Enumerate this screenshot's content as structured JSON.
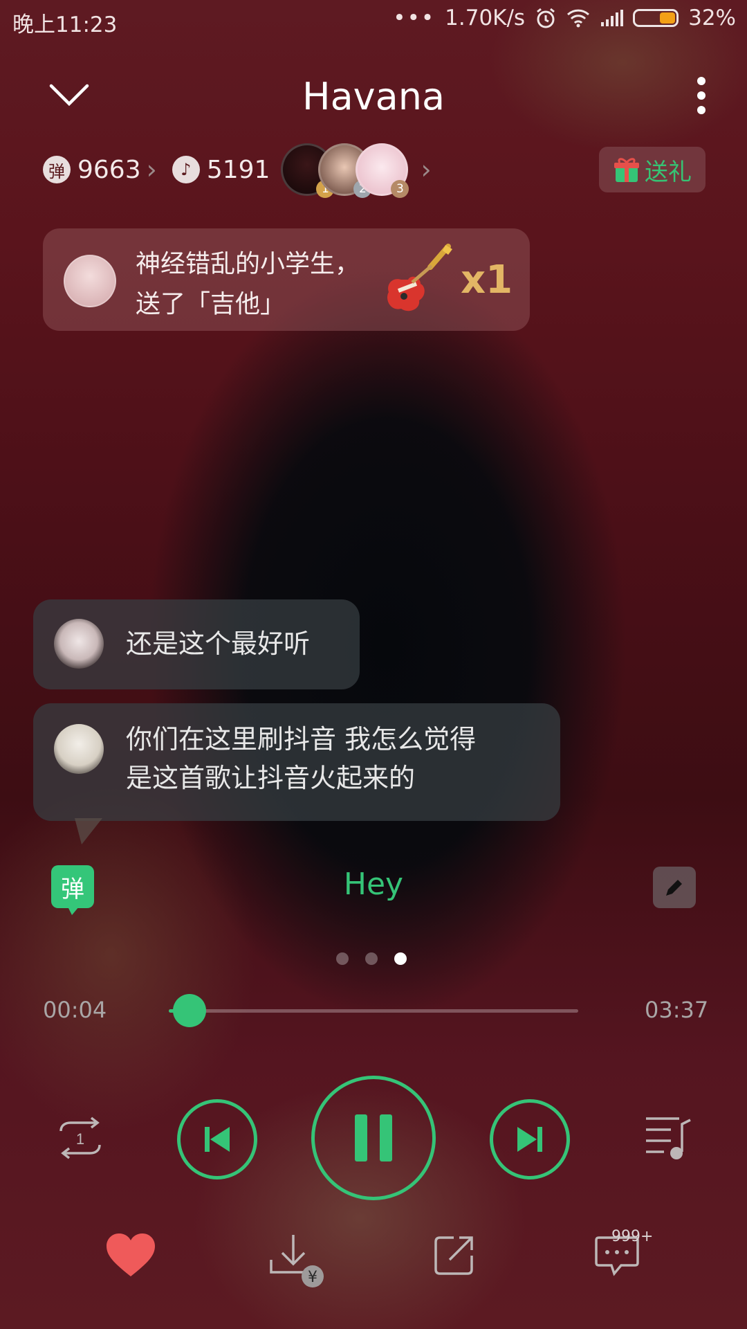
{
  "status_bar": {
    "time": "晚上11:23",
    "network_speed": "1.70K/s",
    "battery_percent": "32%",
    "battery_level": 0.32
  },
  "header": {
    "title": "Havana"
  },
  "stats": {
    "danmaku_badge": "弹",
    "danmaku_count": "9663",
    "coin_count": "5191",
    "ranks": [
      "1",
      "2",
      "3"
    ]
  },
  "gift_button": {
    "label": "送礼"
  },
  "gift_notice": {
    "line1": "神经错乱的小学生，",
    "line2": "送了「吉他」",
    "multiplier": "x1"
  },
  "comments": [
    {
      "text": "还是这个最好听"
    },
    {
      "line1": "你们在这里刷抖音 我怎么觉得",
      "line2": "是这首歌让抖音火起来的"
    }
  ],
  "danmaku_toggle": {
    "label": "弹"
  },
  "lyric": {
    "current": "Hey"
  },
  "pager": {
    "count": 3,
    "active": 2
  },
  "progress": {
    "current": "00:04",
    "total": "03:37",
    "fraction": 0.05
  },
  "bottom_bar": {
    "comment_count": "999+"
  },
  "colors": {
    "accent": "#35c477",
    "gift_gold": "#e3b665",
    "heart": "#ef5a5a"
  }
}
